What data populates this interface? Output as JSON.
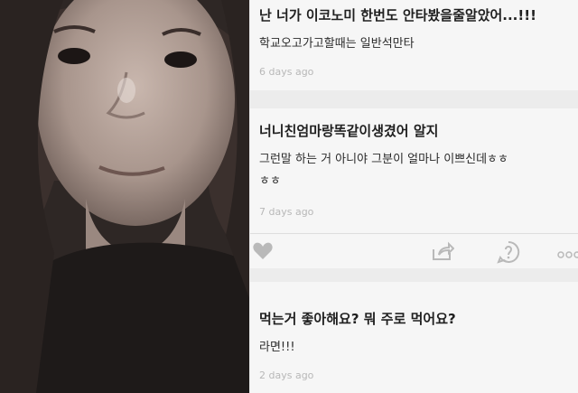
{
  "answers": [
    {
      "question": "난 너가 이코노미 한번도 안타봤을줄알았어...!!!",
      "answer": "학교오고가고할때는 일반석만타",
      "time": "6 days ago"
    },
    {
      "question": "너니친엄마랑똑같이생겼어 알지",
      "answer_line1": "그런말 하는 거 아니야 그분이 얼마나 이쁘신데ㅎㅎ",
      "answer_line2": "ㅎㅎ",
      "time": "7 days ago"
    },
    {
      "question": "먹는거 좋아해요? 뭐 주로 먹어요?",
      "answer": "라면!!!",
      "time": "2 days ago"
    }
  ],
  "action_icons": [
    "heart-icon",
    "share-icon",
    "question-icon",
    "more-icon"
  ],
  "colors": {
    "icon": "#b9b9b9",
    "feed_bg": "#ececec",
    "card_bg": "#f6f6f6"
  }
}
